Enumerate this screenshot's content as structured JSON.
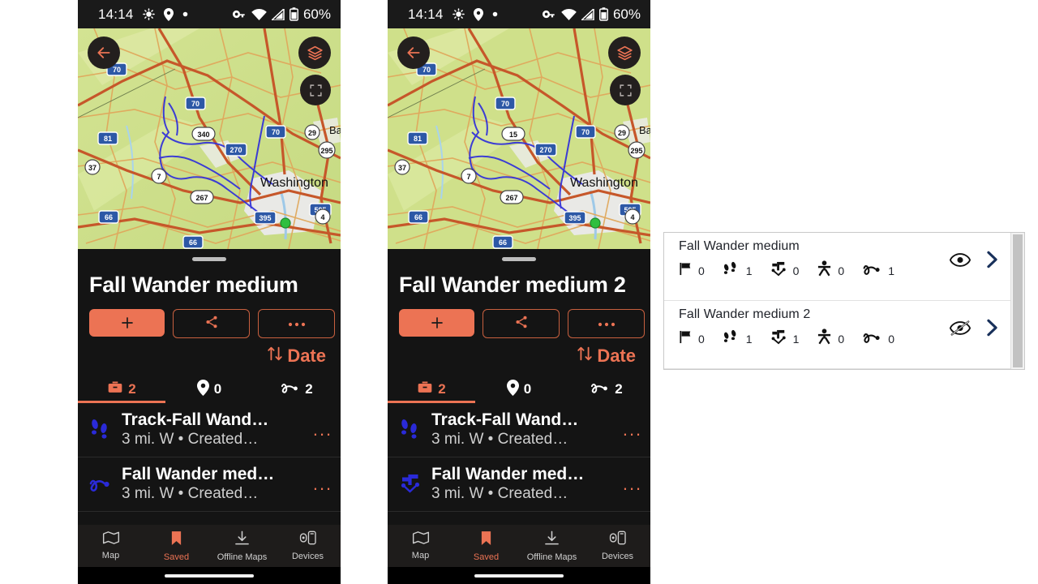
{
  "status_bar": {
    "time": "14:14",
    "battery_percent": "60%",
    "icons": [
      "brightness-icon",
      "location-pin-icon",
      "dot-icon",
      "vpn-key-icon",
      "wifi-icon",
      "cellular-signal-icon",
      "battery-icon"
    ]
  },
  "map": {
    "labels": [
      "70",
      "70",
      "70",
      "81",
      "37",
      "7",
      "340",
      "270",
      "29",
      "295",
      "267",
      "66",
      "66",
      "395",
      "595",
      "4",
      "15"
    ],
    "city_label": "Washington",
    "city_label_partial": "Ba",
    "buttons": {
      "back": "back-arrow",
      "layers": "map-layers",
      "fullscreen": "fullscreen"
    }
  },
  "phone1": {
    "sheet_title": "Fall Wander medium",
    "actions": {
      "add": "+",
      "share": "share-icon",
      "more": "..."
    },
    "sort": {
      "label": "Date",
      "icon": "sort-arrows"
    },
    "tabs": [
      {
        "name": "tracks",
        "icon": "toolbox-icon",
        "count": "2",
        "active": true
      },
      {
        "name": "waypoints",
        "icon": "map-pin-icon",
        "count": "0",
        "active": false
      },
      {
        "name": "routes",
        "icon": "squiggle-route-icon",
        "count": "2",
        "active": false
      }
    ],
    "rows": [
      {
        "icon": "footprints-icon",
        "title": "Track-Fall Wand…",
        "subtitle": "3 mi. W • Created…",
        "more": "..."
      },
      {
        "icon": "squiggle-route-icon",
        "title": "Fall Wander med…",
        "subtitle": "3 mi. W • Created…",
        "more": "..."
      }
    ]
  },
  "phone2": {
    "sheet_title": "Fall Wander medium 2",
    "actions": {
      "add": "+",
      "share": "share-icon",
      "more": "..."
    },
    "sort": {
      "label": "Date",
      "icon": "sort-arrows"
    },
    "tabs": [
      {
        "name": "tracks",
        "icon": "toolbox-icon",
        "count": "2",
        "active": true
      },
      {
        "name": "waypoints",
        "icon": "map-pin-icon",
        "count": "0",
        "active": false
      },
      {
        "name": "routes",
        "icon": "squiggle-route-icon",
        "count": "2",
        "active": false
      }
    ],
    "rows": [
      {
        "icon": "footprints-icon",
        "title": "Track-Fall Wand…",
        "subtitle": "3 mi. W • Created…",
        "more": "..."
      },
      {
        "icon": "waypoint-marker-icon",
        "title": "Fall Wander med…",
        "subtitle": "3 mi. W • Created…",
        "more": "..."
      }
    ]
  },
  "bottom_nav": [
    {
      "label": "Map",
      "icon": "map-icon",
      "active": false
    },
    {
      "label": "Saved",
      "icon": "bookmark-icon",
      "active": true
    },
    {
      "label": "Offline Maps",
      "icon": "download-icon",
      "active": false
    },
    {
      "label": "Devices",
      "icon": "devices-icon",
      "active": false
    }
  ],
  "panel": {
    "rows": [
      {
        "title": "Fall Wander medium",
        "stats": [
          {
            "icon": "flag-icon",
            "value": "0"
          },
          {
            "icon": "footprints-icon",
            "value": "1"
          },
          {
            "icon": "waypoint-marker-icon",
            "value": "0"
          },
          {
            "icon": "person-icon",
            "value": "0"
          },
          {
            "icon": "squiggle-route-icon",
            "value": "1"
          }
        ],
        "visibility": "eye-visible-icon",
        "chevron": "chevron-right-icon"
      },
      {
        "title": "Fall Wander medium 2",
        "stats": [
          {
            "icon": "flag-icon",
            "value": "0"
          },
          {
            "icon": "footprints-icon",
            "value": "1"
          },
          {
            "icon": "waypoint-marker-icon",
            "value": "1"
          },
          {
            "icon": "person-icon",
            "value": "0"
          },
          {
            "icon": "squiggle-route-icon",
            "value": "0"
          }
        ],
        "visibility": "eye-hidden-icon",
        "chevron": "chevron-right-icon"
      }
    ]
  },
  "colors": {
    "accent": "#ec7354",
    "sheet_bg": "#141414",
    "statusbar_bg": "#1a1a1a",
    "panel_bg": "#ffffff",
    "route_blue": "#2a2ad0"
  }
}
